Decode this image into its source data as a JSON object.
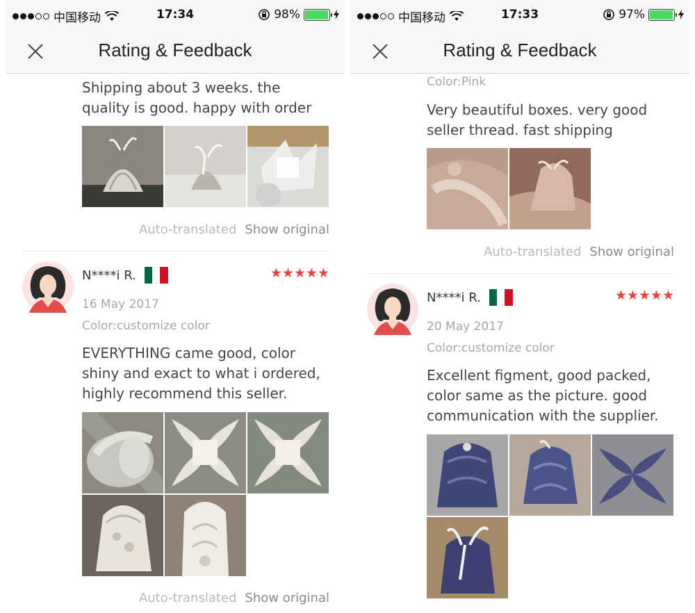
{
  "left": {
    "status": {
      "carrier": "中国移动",
      "time": "17:34",
      "battery": "98%",
      "battery_level": 0.98
    },
    "nav": {
      "title": "Rating & Feedback"
    },
    "review_top": {
      "text": "Shipping about 3 weeks. the quality is good. happy with order",
      "auto_translated": "Auto-translated",
      "show_original": "Show original"
    },
    "review_main": {
      "name": "N****i R.",
      "stars": "★★★★★",
      "date": "16 May 2017",
      "color": "Color:customize color",
      "text": "EVERYTHING came good, color shiny and exact to what i ordered, highly recommend this seller.",
      "auto_translated": "Auto-translated",
      "show_original": "Show original"
    }
  },
  "right": {
    "status": {
      "carrier": "中国移动",
      "time": "17:33",
      "battery": "97%",
      "battery_level": 0.97
    },
    "nav": {
      "title": "Rating & Feedback"
    },
    "review_top": {
      "color": "Color:Pink",
      "text": "Very beautiful boxes. very good seller thread. fast shipping",
      "auto_translated": "Auto-translated",
      "show_original": "Show original"
    },
    "review_main": {
      "name": "N****i R.",
      "stars": "★★★★★",
      "date": "20 May 2017",
      "color": "Color:customize color",
      "text": "Excellent figment, good packed, color same as the picture. good communication with the supplier."
    }
  },
  "colors": {
    "star": "#e8463c",
    "flag_green": "#006847",
    "flag_red": "#ce1126"
  }
}
